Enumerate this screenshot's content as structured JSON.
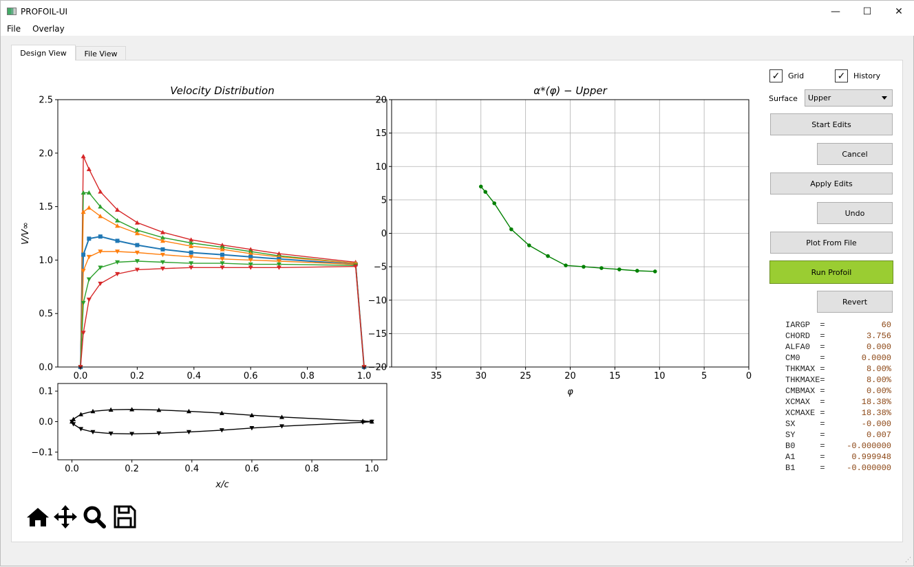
{
  "window": {
    "title": "PROFOIL-UI",
    "controls": [
      "minimize",
      "maximize",
      "close"
    ]
  },
  "menu": [
    "File",
    "Overlay"
  ],
  "tabs": [
    {
      "label": "Design View",
      "active": true
    },
    {
      "label": "File View",
      "active": false
    }
  ],
  "controls": {
    "grid_label": "Grid",
    "grid_checked": true,
    "history_label": "History",
    "history_checked": true,
    "surface_label": "Surface",
    "surface_value": "Upper",
    "buttons": {
      "start_edits": "Start Edits",
      "cancel": "Cancel",
      "apply_edits": "Apply Edits",
      "undo": "Undo",
      "plot_from_file": "Plot From File",
      "run_profoil": "Run Profoil",
      "revert": "Revert"
    },
    "run_color": "#9acd32"
  },
  "parameters": [
    {
      "name": "IARGP",
      "value": "60"
    },
    {
      "name": "CHORD",
      "value": "3.756"
    },
    {
      "name": "ALFA0",
      "value": "0.000"
    },
    {
      "name": "CM0",
      "value": "0.0000"
    },
    {
      "name": "THKMAX",
      "value": "8.00%"
    },
    {
      "name": "THKMAXE",
      "value": "8.00%"
    },
    {
      "name": "CMBMAX",
      "value": "0.00%"
    },
    {
      "name": "XCMAX",
      "value": "18.38%"
    },
    {
      "name": "XCMAXE",
      "value": "18.38%"
    },
    {
      "name": "SX",
      "value": "-0.000"
    },
    {
      "name": "SY",
      "value": "0.007"
    },
    {
      "name": "B0",
      "value": "-0.000000"
    },
    {
      "name": "A1",
      "value": "0.999948"
    },
    {
      "name": "B1",
      "value": "-0.000000"
    }
  ],
  "toolbar": [
    "home-icon",
    "pan-icon",
    "zoom-icon",
    "save-icon"
  ],
  "chart_data": [
    {
      "type": "line",
      "title": "Velocity Distribution",
      "xlabel": "",
      "ylabel": "V/V∞",
      "xlim": [
        -0.08,
        1.08
      ],
      "ylim": [
        0,
        2.5
      ],
      "xticks": [
        "0.0",
        "0.2",
        "0.4",
        "0.6",
        "0.8",
        "1.0"
      ],
      "xtick_values": [
        0,
        0.2,
        0.4,
        0.6,
        0.8,
        1.0
      ],
      "yticks": [
        "0.0",
        "0.5",
        "1.0",
        "1.5",
        "2.0",
        "2.5"
      ],
      "ytick_values": [
        0,
        0.5,
        1.0,
        1.5,
        2.0,
        2.5
      ],
      "grid": false,
      "x": [
        0,
        0.01,
        0.03,
        0.07,
        0.13,
        0.2,
        0.29,
        0.39,
        0.5,
        0.6,
        0.7,
        0.97,
        1.0
      ],
      "series": [
        {
          "color": "#d62728",
          "marker": "triangle-up",
          "values": [
            0,
            1.97,
            1.85,
            1.64,
            1.47,
            1.35,
            1.26,
            1.19,
            1.14,
            1.1,
            1.06,
            0.98,
            0
          ]
        },
        {
          "color": "#2ca02c",
          "marker": "triangle-up",
          "values": [
            0,
            1.63,
            1.63,
            1.5,
            1.37,
            1.28,
            1.21,
            1.16,
            1.12,
            1.08,
            1.04,
            0.97,
            0
          ]
        },
        {
          "color": "#ff7f0e",
          "marker": "triangle-up",
          "values": [
            0,
            1.45,
            1.49,
            1.41,
            1.32,
            1.25,
            1.18,
            1.13,
            1.1,
            1.06,
            1.03,
            0.97,
            0
          ]
        },
        {
          "color": "#1f77b4",
          "marker": "square",
          "values": [
            0,
            1.05,
            1.2,
            1.22,
            1.18,
            1.14,
            1.1,
            1.07,
            1.05,
            1.03,
            1.01,
            0.96,
            0
          ]
        },
        {
          "color": "#ff7f0e",
          "marker": "triangle-down",
          "values": [
            0,
            0.9,
            1.03,
            1.08,
            1.08,
            1.07,
            1.05,
            1.03,
            1.01,
            1.0,
            0.99,
            0.96,
            0
          ]
        },
        {
          "color": "#2ca02c",
          "marker": "triangle-down",
          "values": [
            0,
            0.6,
            0.82,
            0.93,
            0.98,
            0.99,
            0.98,
            0.97,
            0.97,
            0.96,
            0.96,
            0.95,
            0
          ]
        },
        {
          "color": "#d62728",
          "marker": "triangle-down",
          "values": [
            0,
            0.32,
            0.63,
            0.78,
            0.87,
            0.91,
            0.92,
            0.93,
            0.93,
            0.93,
            0.93,
            0.94,
            0
          ]
        }
      ]
    },
    {
      "type": "line",
      "title": "α*(φ) − Upper",
      "xlabel": "φ",
      "ylabel": "",
      "xlim": [
        40,
        0
      ],
      "ylim": [
        -20,
        20
      ],
      "xticks": [
        "35",
        "30",
        "25",
        "20",
        "15",
        "10",
        "5",
        "0"
      ],
      "xtick_values": [
        35,
        30,
        25,
        20,
        15,
        10,
        5,
        0
      ],
      "yticks": [
        "−20",
        "−15",
        "−10",
        "−5",
        "0",
        "5",
        "10",
        "15",
        "20"
      ],
      "ytick_values": [
        -20,
        -15,
        -10,
        -5,
        0,
        5,
        10,
        15,
        20
      ],
      "grid": true,
      "series": [
        {
          "color": "#008000",
          "marker": "circle",
          "x": [
            30,
            29.5,
            28.5,
            26.6,
            24.6,
            22.5,
            20.5,
            18.5,
            16.5,
            14.5,
            12.5,
            10.5
          ],
          "values": [
            7.0,
            6.2,
            4.5,
            0.6,
            -1.8,
            -3.4,
            -4.8,
            -5.0,
            -5.2,
            -5.4,
            -5.6,
            -5.7
          ]
        }
      ]
    },
    {
      "type": "line",
      "title": "",
      "xlabel": "x/c",
      "ylabel": "",
      "xlim": [
        -0.047,
        1.05
      ],
      "ylim": [
        -0.125,
        0.125
      ],
      "xticks": [
        "0.0",
        "0.2",
        "0.4",
        "0.6",
        "0.8",
        "1.0"
      ],
      "xtick_values": [
        0,
        0.2,
        0.4,
        0.6,
        0.8,
        1.0
      ],
      "yticks": [
        "−0.1",
        "0.0",
        "0.1"
      ],
      "ytick_values": [
        -0.1,
        0,
        0.1
      ],
      "grid": false,
      "series": [
        {
          "color": "#000000",
          "marker": "triangle-up",
          "x": [
            0,
            0.005,
            0.03,
            0.07,
            0.13,
            0.2,
            0.29,
            0.39,
            0.5,
            0.6,
            0.7,
            0.97,
            1.0
          ],
          "values": [
            0,
            0.008,
            0.024,
            0.034,
            0.039,
            0.04,
            0.038,
            0.034,
            0.028,
            0.021,
            0.015,
            0.002,
            0
          ]
        },
        {
          "color": "#000000",
          "marker": "triangle-down",
          "x": [
            0,
            0.005,
            0.03,
            0.07,
            0.13,
            0.2,
            0.29,
            0.39,
            0.5,
            0.6,
            0.7,
            0.97,
            1.0
          ],
          "values": [
            0,
            -0.008,
            -0.024,
            -0.034,
            -0.039,
            -0.04,
            -0.038,
            -0.034,
            -0.028,
            -0.021,
            -0.015,
            -0.002,
            0
          ]
        }
      ]
    }
  ]
}
